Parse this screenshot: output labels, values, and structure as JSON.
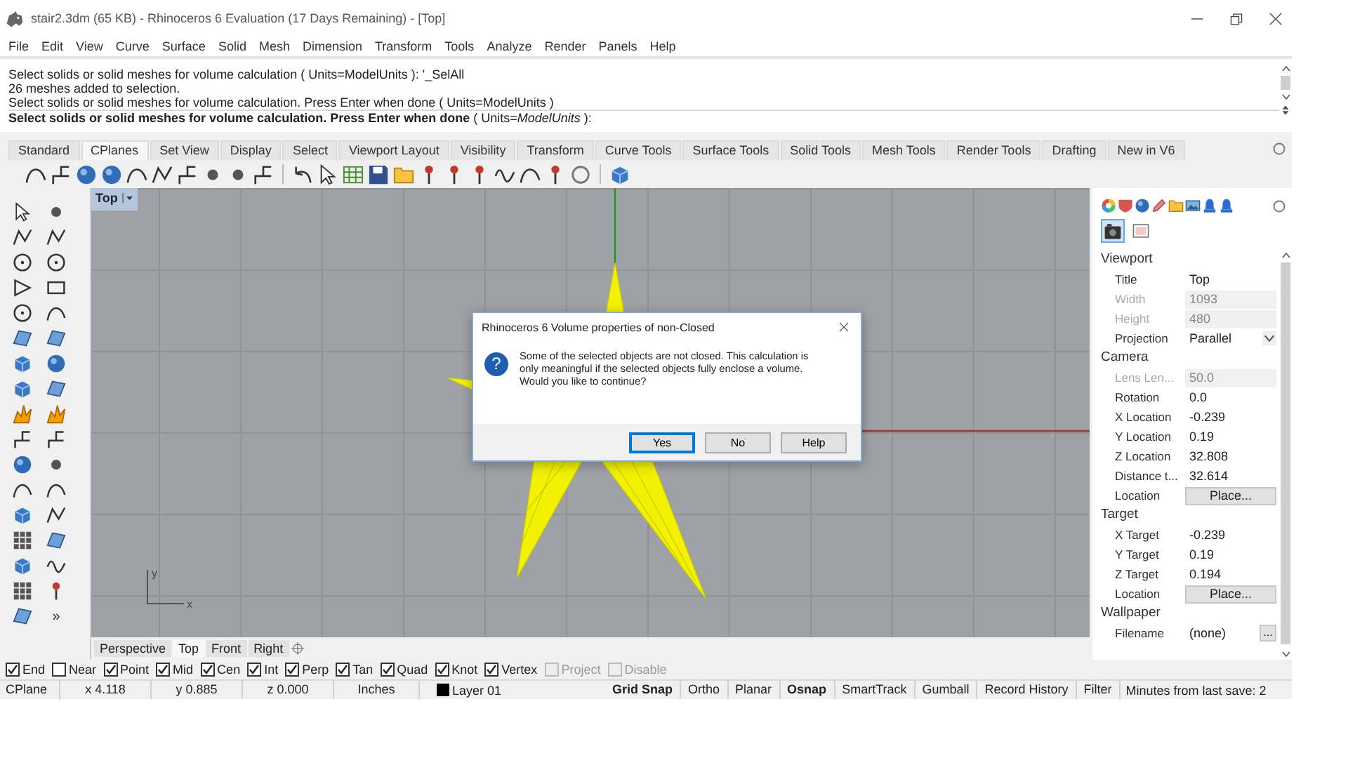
{
  "window": {
    "title": "stair2.3dm (65 KB) - Rhinoceros 6 Evaluation (17 Days Remaining) - [Top]"
  },
  "menu": [
    "File",
    "Edit",
    "View",
    "Curve",
    "Surface",
    "Solid",
    "Mesh",
    "Dimension",
    "Transform",
    "Tools",
    "Analyze",
    "Render",
    "Panels",
    "Help"
  ],
  "command_history": [
    "Select solids or solid meshes for volume calculation ( Units=ModelUnits ): '_SelAll",
    "26 meshes added to selection.",
    "Select solids or solid meshes for volume calculation. Press Enter when done ( Units=ModelUnits )"
  ],
  "command_prompt": "**Select solids or solid meshes for volume calculation. Press Enter when done** ( Units=*ModelUnits* ):",
  "toolbar_tabs": [
    {
      "label": "Standard",
      "selected": false
    },
    {
      "label": "CPlanes",
      "selected": true
    },
    {
      "label": "Set View",
      "selected": false
    },
    {
      "label": "Display",
      "selected": false
    },
    {
      "label": "Select",
      "selected": false
    },
    {
      "label": "Viewport Layout",
      "selected": false
    },
    {
      "label": "Visibility",
      "selected": false
    },
    {
      "label": "Transform",
      "selected": false
    },
    {
      "label": "Curve Tools",
      "selected": false
    },
    {
      "label": "Surface Tools",
      "selected": false
    },
    {
      "label": "Solid Tools",
      "selected": false
    },
    {
      "label": "Mesh Tools",
      "selected": false
    },
    {
      "label": "Render Tools",
      "selected": false
    },
    {
      "label": "Drafting",
      "selected": false
    },
    {
      "label": "New in V6",
      "selected": false
    }
  ],
  "left_toolbar": {
    "overflow": "»"
  },
  "viewport": {
    "title": "Top",
    "axis_labels": [
      "y",
      "x"
    ],
    "tabs": [
      {
        "label": "Perspective",
        "selected": false
      },
      {
        "label": "Top",
        "selected": true
      },
      {
        "label": "Front",
        "selected": false
      },
      {
        "label": "Right",
        "selected": false
      }
    ]
  },
  "dialog": {
    "title": "Rhinoceros 6  Volume properties of non-Closed",
    "icon": "?",
    "message": "Some of the selected objects are not closed. This calculation is\nonly meaningful if the selected objects fully enclose a volume.\n Would you like to continue?",
    "buttons": [
      {
        "label": "Yes",
        "selected": true
      },
      {
        "label": "No",
        "selected": false
      },
      {
        "label": "Help",
        "selected": false
      }
    ]
  },
  "properties_panel": {
    "tabs": [
      {
        "kind": "camera",
        "selected": true
      },
      {
        "kind": "frame",
        "selected": false
      }
    ],
    "sections": [
      {
        "title": "Viewport",
        "rows": [
          {
            "label": "Title",
            "value": "Top",
            "kind": "text",
            "disabled": false
          },
          {
            "label": "Width",
            "value": "1093",
            "kind": "text",
            "disabled": true
          },
          {
            "label": "Height",
            "value": "480",
            "kind": "text",
            "disabled": true
          },
          {
            "label": "Projection",
            "value": "Parallel",
            "kind": "dropdown",
            "disabled": false
          }
        ]
      },
      {
        "title": "Camera",
        "rows": [
          {
            "label": "Lens Len...",
            "value": "50.0",
            "kind": "text",
            "disabled": true
          },
          {
            "label": "Rotation",
            "value": "0.0",
            "kind": "text",
            "disabled": false
          },
          {
            "label": "X Location",
            "value": "-0.239",
            "kind": "text",
            "disabled": false
          },
          {
            "label": "Y Location",
            "value": "0.19",
            "kind": "text",
            "disabled": false
          },
          {
            "label": "Z Location",
            "value": "32.808",
            "kind": "text",
            "disabled": false
          },
          {
            "label": "Distance t...",
            "value": "32.614",
            "kind": "text",
            "disabled": false
          },
          {
            "label": "Location",
            "value": "Place...",
            "kind": "button",
            "disabled": false
          }
        ]
      },
      {
        "title": "Target",
        "rows": [
          {
            "label": "X Target",
            "value": "-0.239",
            "kind": "text",
            "disabled": false
          },
          {
            "label": "Y Target",
            "value": "0.19",
            "kind": "text",
            "disabled": false
          },
          {
            "label": "Z Target",
            "value": "0.194",
            "kind": "text",
            "disabled": false
          },
          {
            "label": "Location",
            "value": "Place...",
            "kind": "button",
            "disabled": false
          }
        ]
      },
      {
        "title": "Wallpaper",
        "rows": [
          {
            "label": "Filename",
            "value": "(none)",
            "kind": "browse",
            "button": "...",
            "disabled": false
          }
        ]
      }
    ]
  },
  "osnaps": [
    {
      "label": "End",
      "checked": true,
      "disabled": false
    },
    {
      "label": "Near",
      "checked": false,
      "disabled": false
    },
    {
      "label": "Point",
      "checked": true,
      "disabled": false
    },
    {
      "label": "Mid",
      "checked": true,
      "disabled": false
    },
    {
      "label": "Cen",
      "checked": true,
      "disabled": false
    },
    {
      "label": "Int",
      "checked": true,
      "disabled": false
    },
    {
      "label": "Perp",
      "checked": true,
      "disabled": false
    },
    {
      "label": "Tan",
      "checked": true,
      "disabled": false
    },
    {
      "label": "Quad",
      "checked": true,
      "disabled": false
    },
    {
      "label": "Knot",
      "checked": true,
      "disabled": false
    },
    {
      "label": "Vertex",
      "checked": true,
      "disabled": false
    },
    {
      "label": "Project",
      "checked": false,
      "disabled": true
    },
    {
      "label": "Disable",
      "checked": false,
      "disabled": true
    }
  ],
  "status_bar": {
    "cplane": "CPlane",
    "x": "x 4.118",
    "y": "y 0.885",
    "z": "z 0.000",
    "units": "Inches",
    "layer": {
      "name": "Layer 01",
      "color": "#000000"
    },
    "toggles": [
      {
        "label": "Grid Snap",
        "on": true
      },
      {
        "label": "Ortho",
        "on": false
      },
      {
        "label": "Planar",
        "on": false
      },
      {
        "label": "Osnap",
        "on": true
      },
      {
        "label": "SmartTrack",
        "on": false
      },
      {
        "label": "Gumball",
        "on": false
      },
      {
        "label": "Record History",
        "on": false
      },
      {
        "label": "Filter",
        "on": false
      }
    ],
    "save_info": "Minutes from last save: 2"
  }
}
